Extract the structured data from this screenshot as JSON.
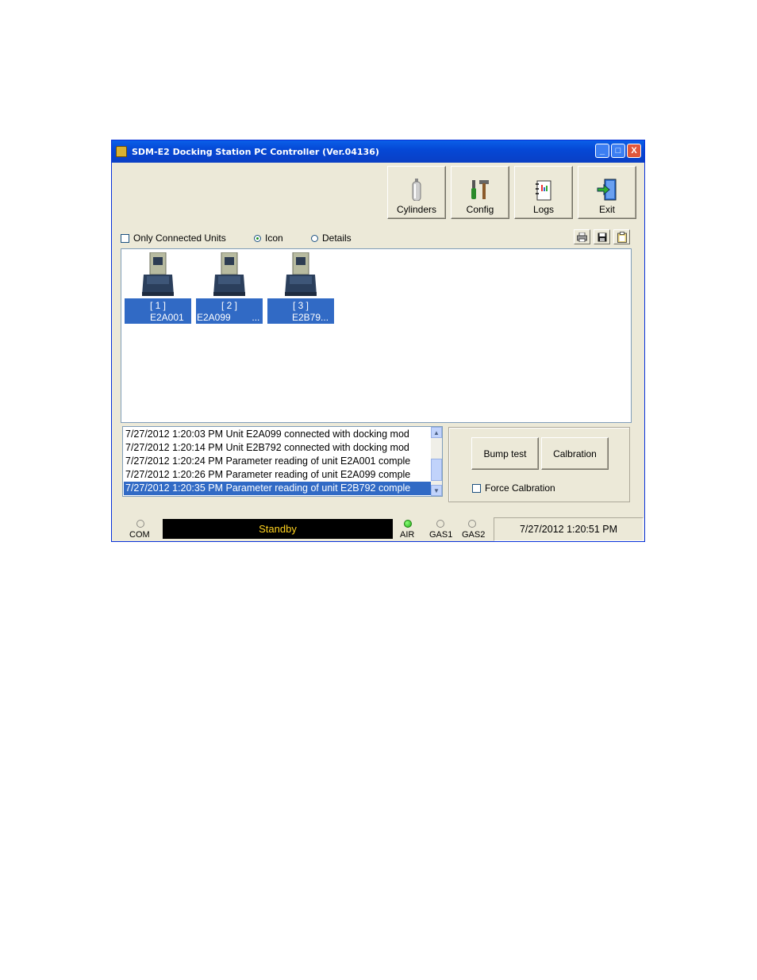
{
  "window": {
    "title": "SDM-E2 Docking Station PC Controller (Ver.04136)",
    "controls": [
      "_",
      "□",
      "X"
    ]
  },
  "toolbar": {
    "cylinders": "Cylinders",
    "config": "Config",
    "logs": "Logs",
    "exit": "Exit"
  },
  "options": {
    "only_connected": "Only Connected Units",
    "icon": "Icon",
    "details": "Details",
    "view_selected": "Icon"
  },
  "units": [
    {
      "slot": "[ 1 ]",
      "serial": "E2A001"
    },
    {
      "slot": "[ 2 ]",
      "serial": "E2A099        ..."
    },
    {
      "slot": "[ 3 ]",
      "serial": "E2B79..."
    }
  ],
  "log": [
    "7/27/2012 1:20:03 PM Unit E2A099 connected with docking mod",
    "7/27/2012 1:20:14 PM Unit E2B792 connected with docking mod",
    "7/27/2012 1:20:24 PM Parameter reading of unit E2A001 comple",
    "7/27/2012 1:20:26 PM Parameter reading of unit E2A099 comple",
    "7/27/2012 1:20:35 PM Parameter reading of unit E2B792 comple"
  ],
  "actions": {
    "bump": "Bump test",
    "calibration": "Calbration",
    "force": "Force Calbration"
  },
  "status": {
    "com": "COM",
    "standby": "Standby",
    "air": "AIR",
    "gas1": "GAS1",
    "gas2": "GAS2",
    "datetime": "7/27/2012 1:20:51 PM"
  },
  "colors": {
    "selection": "#316ac5",
    "standby_text": "#ffd21f",
    "air_lamp": "#22b014"
  }
}
